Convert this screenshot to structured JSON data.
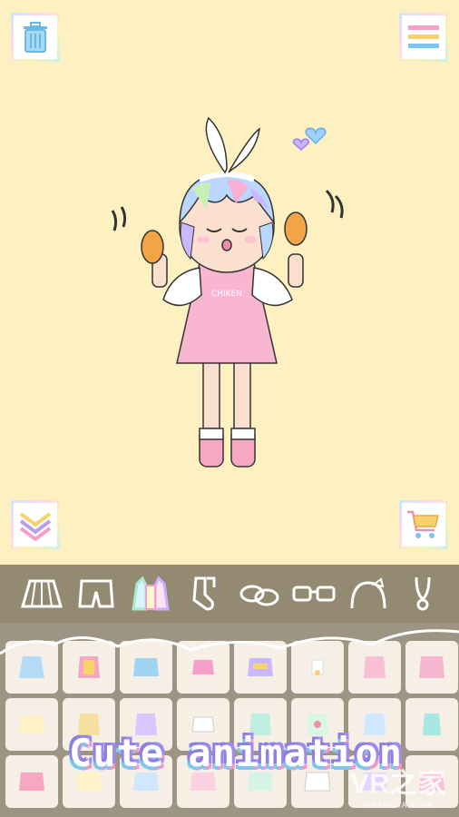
{
  "caption": "Cute animation",
  "watermark": {
    "logo": "VR之家",
    "url": "VRZHIJIA.COM"
  },
  "buttons": {
    "trash": "trash-icon",
    "menu": "menu-icon",
    "collapse": "chevron-down-icon",
    "shop": "cart-icon"
  },
  "categories": [
    {
      "name": "skirt"
    },
    {
      "name": "shorts"
    },
    {
      "name": "top",
      "selected": true
    },
    {
      "name": "socks"
    },
    {
      "name": "shoes"
    },
    {
      "name": "glasses"
    },
    {
      "name": "headband"
    },
    {
      "name": "accessory"
    }
  ],
  "colors": {
    "background": "#fdf1c2",
    "bar": "#948a72",
    "panel": "#9e9483"
  }
}
